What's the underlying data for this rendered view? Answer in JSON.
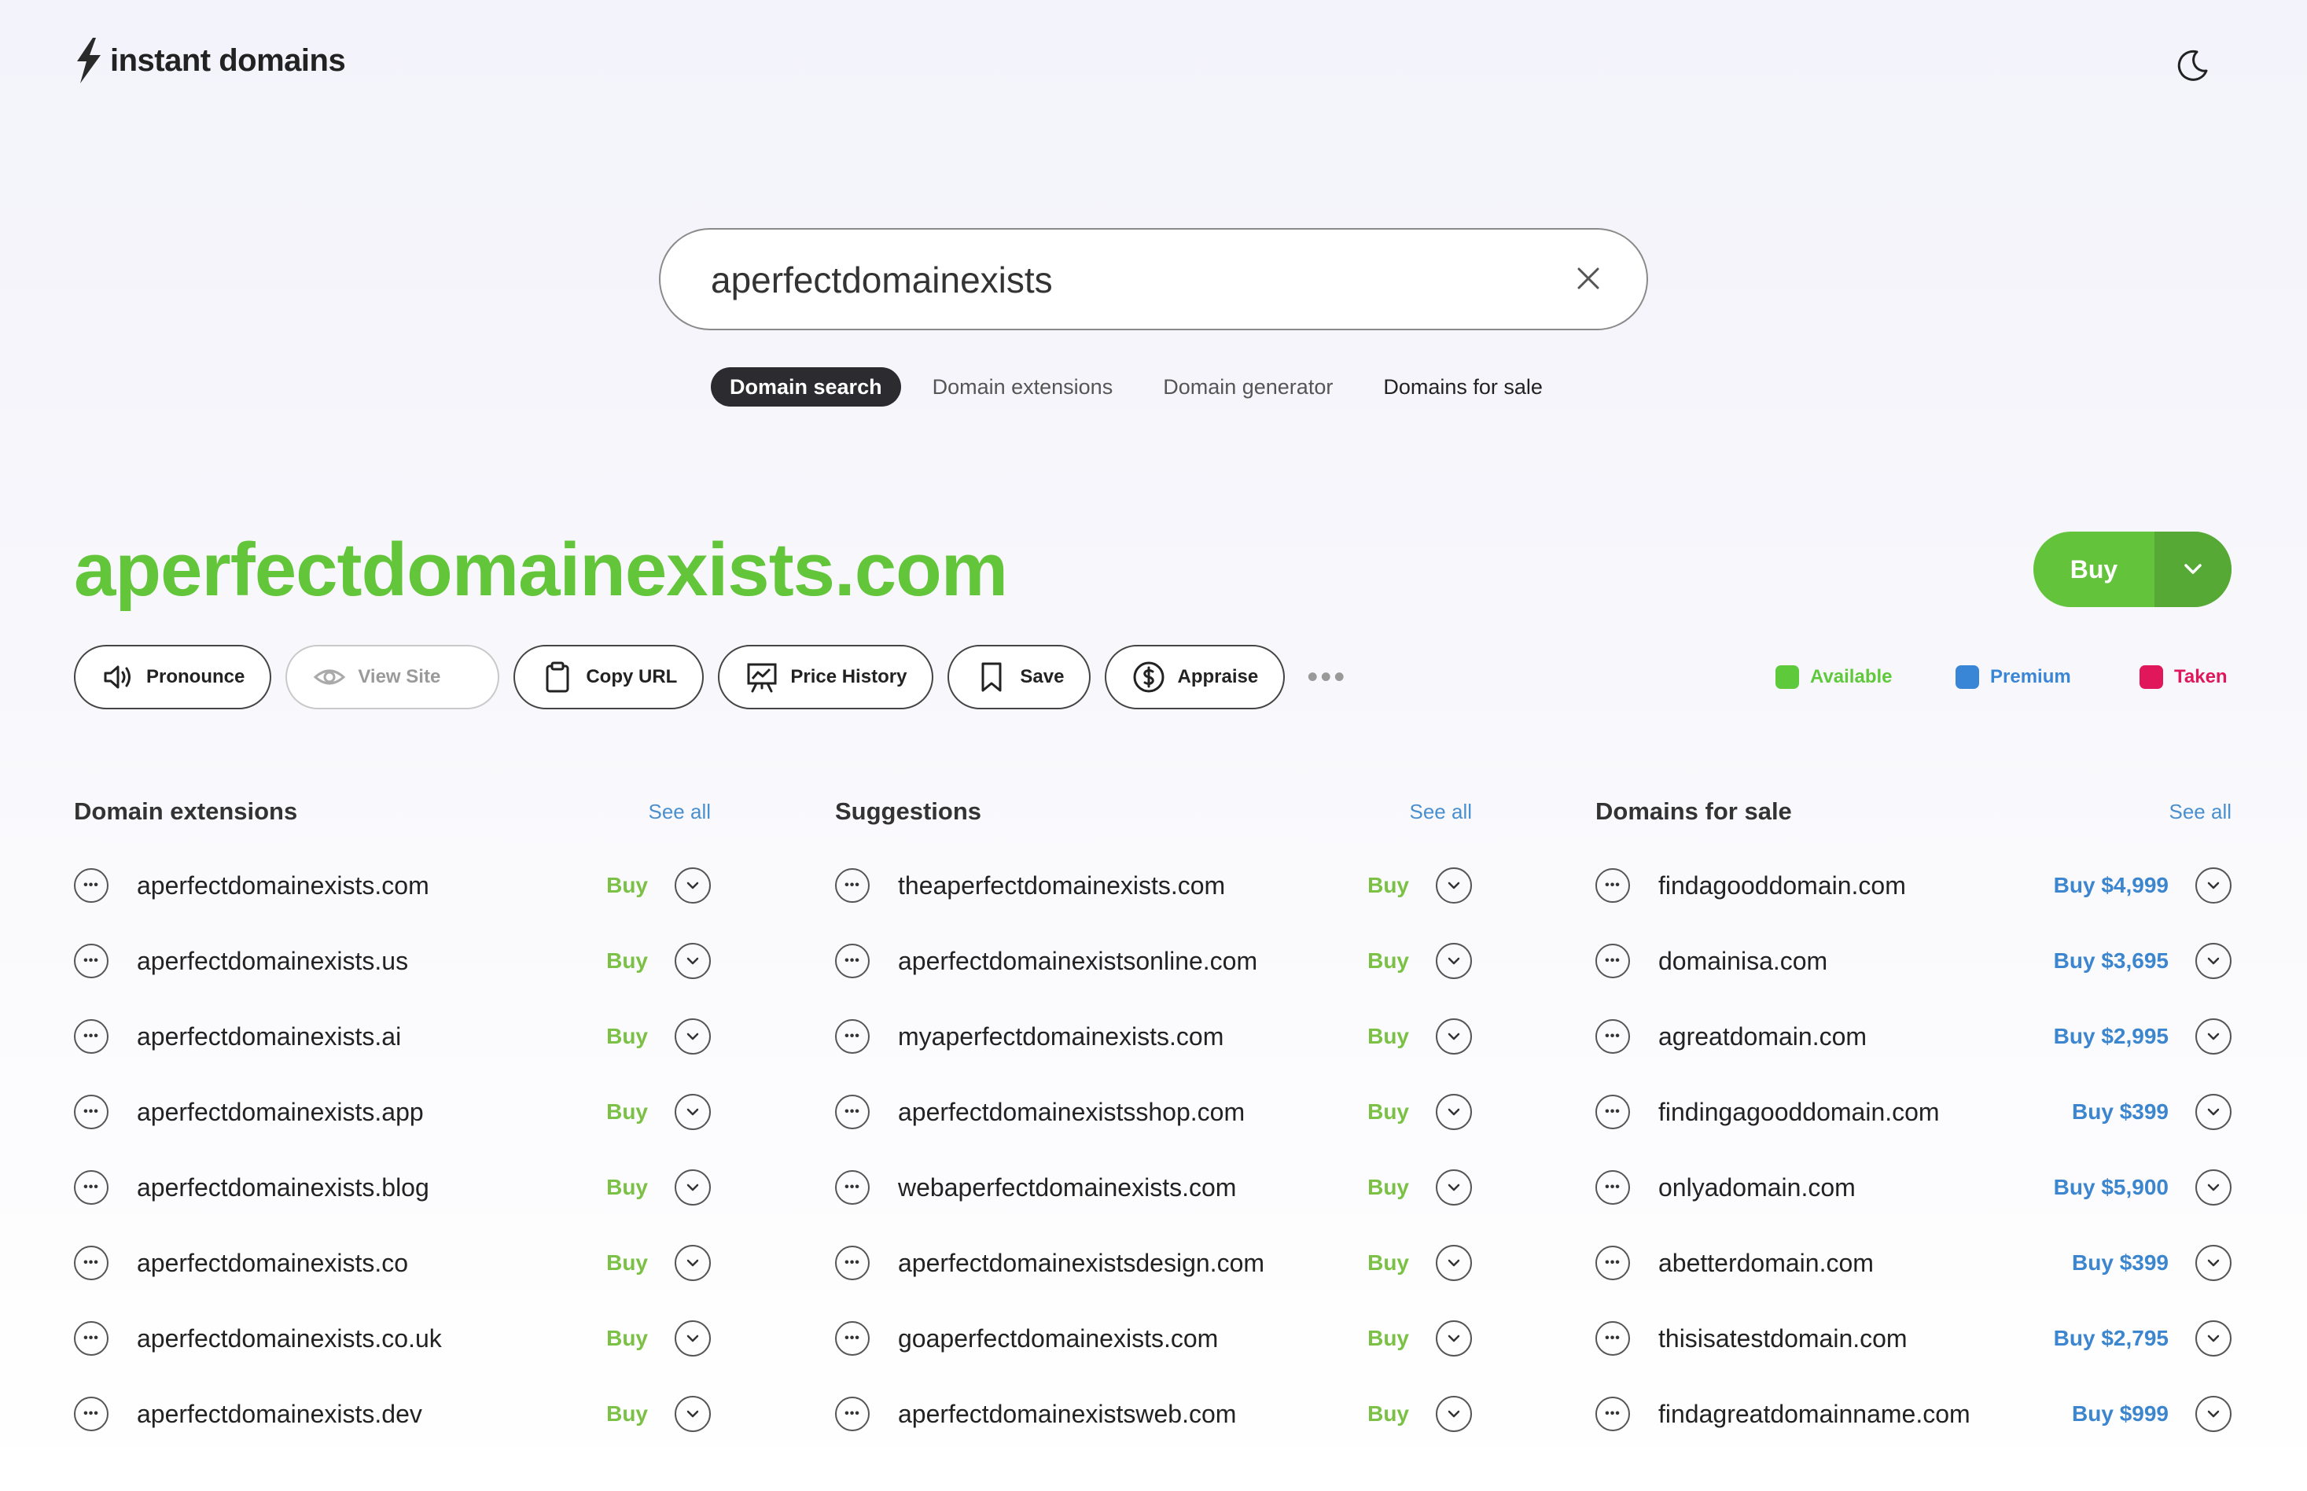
{
  "brand": {
    "name": "instant domains"
  },
  "search": {
    "value": "aperfectdomainexists"
  },
  "tabs": [
    {
      "label": "Domain search"
    },
    {
      "label": "Domain extensions"
    },
    {
      "label": "Domain generator"
    },
    {
      "label": "Domains for sale"
    }
  ],
  "result": {
    "domain": "aperfectdomainexists.com",
    "buy_label": "Buy"
  },
  "actions": [
    {
      "label": "Pronounce"
    },
    {
      "label": "View Site"
    },
    {
      "label": "Copy URL"
    },
    {
      "label": "Price History"
    },
    {
      "label": "Save"
    },
    {
      "label": "Appraise"
    }
  ],
  "legend": [
    {
      "label": "Available",
      "color": "#5fc93c"
    },
    {
      "label": "Premium",
      "color": "#3a86d6"
    },
    {
      "label": "Taken",
      "color": "#e0175b"
    }
  ],
  "columns": [
    {
      "title": "Domain extensions",
      "see_all": "See all",
      "rows": [
        {
          "name": "aperfectdomainexists.com",
          "buy": "Buy"
        },
        {
          "name": "aperfectdomainexists.us",
          "buy": "Buy"
        },
        {
          "name": "aperfectdomainexists.ai",
          "buy": "Buy"
        },
        {
          "name": "aperfectdomainexists.app",
          "buy": "Buy"
        },
        {
          "name": "aperfectdomainexists.blog",
          "buy": "Buy"
        },
        {
          "name": "aperfectdomainexists.co",
          "buy": "Buy"
        },
        {
          "name": "aperfectdomainexists.co.uk",
          "buy": "Buy"
        },
        {
          "name": "aperfectdomainexists.dev",
          "buy": "Buy"
        }
      ]
    },
    {
      "title": "Suggestions",
      "see_all": "See all",
      "rows": [
        {
          "name": "theaperfectdomainexists.com",
          "buy": "Buy"
        },
        {
          "name": "aperfectdomainexistsonline.com",
          "buy": "Buy"
        },
        {
          "name": "myaperfectdomainexists.com",
          "buy": "Buy"
        },
        {
          "name": "aperfectdomainexistsshop.com",
          "buy": "Buy"
        },
        {
          "name": "webaperfectdomainexists.com",
          "buy": "Buy"
        },
        {
          "name": "aperfectdomainexistsdesign.com",
          "buy": "Buy"
        },
        {
          "name": "goaperfectdomainexists.com",
          "buy": "Buy"
        },
        {
          "name": "aperfectdomainexistsweb.com",
          "buy": "Buy"
        }
      ]
    },
    {
      "title": "Domains for sale",
      "see_all": "See all",
      "rows": [
        {
          "name": "findagooddomain.com",
          "buy": "Buy $4,999"
        },
        {
          "name": "domainisa.com",
          "buy": "Buy $3,695"
        },
        {
          "name": "agreatdomain.com",
          "buy": "Buy $2,995"
        },
        {
          "name": "findingagooddomain.com",
          "buy": "Buy $399"
        },
        {
          "name": "onlyadomain.com",
          "buy": "Buy $5,900"
        },
        {
          "name": "abetterdomain.com",
          "buy": "Buy $399"
        },
        {
          "name": "thisisatestdomain.com",
          "buy": "Buy $2,795"
        },
        {
          "name": "findagreatdomainname.com",
          "buy": "Buy $999"
        }
      ]
    }
  ]
}
